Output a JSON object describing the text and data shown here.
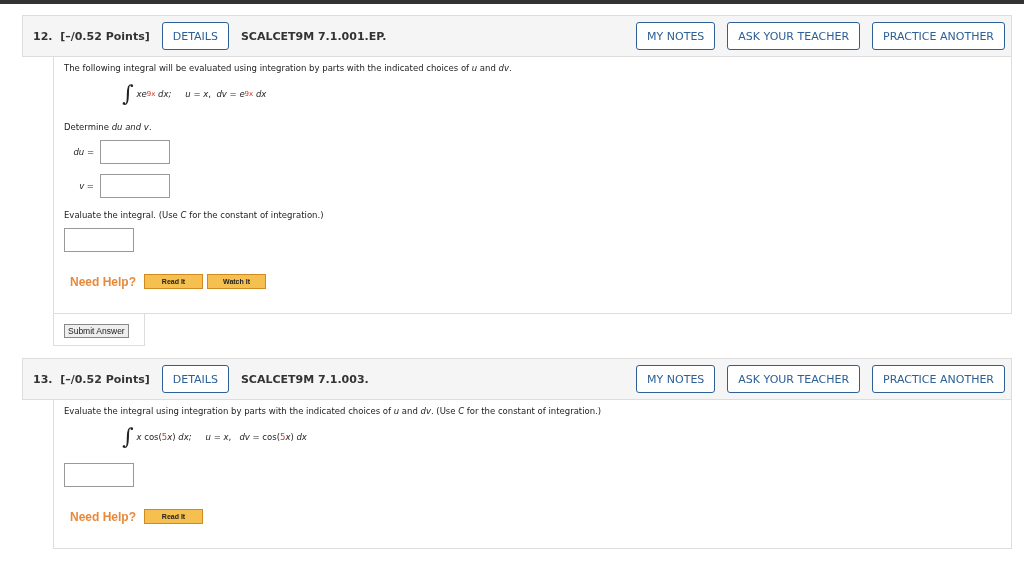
{
  "questions": [
    {
      "number": "12.",
      "points": "[–/0.52 Points]",
      "details": "DETAILS",
      "code": "SCALCET9M 7.1.001.EP.",
      "actions": [
        "MY NOTES",
        "ASK YOUR TEACHER",
        "PRACTICE ANOTHER"
      ],
      "blocks": [
        {
          "kind": "text",
          "text": "The following integral will be evaluated using integration by parts with the indicated choices of *u* and *dv*."
        },
        {
          "kind": "formula",
          "sign": "∫",
          "tokens": [
            {
              "kind": "var",
              "text": "xe"
            },
            {
              "kind": "sup",
              "text": "9x"
            },
            {
              "kind": "var",
              "text": " dx;"
            },
            {
              "kind": "gap"
            },
            {
              "kind": "var",
              "text": "u"
            },
            {
              "kind": "plain",
              "text": " = "
            },
            {
              "kind": "var",
              "text": "x"
            },
            {
              "kind": "plain",
              "text": ",  "
            },
            {
              "kind": "var",
              "text": "dv"
            },
            {
              "kind": "plain",
              "text": " = "
            },
            {
              "kind": "var",
              "text": "e"
            },
            {
              "kind": "sup",
              "text": "9x"
            },
            {
              "kind": "var",
              "text": " dx"
            }
          ]
        },
        {
          "kind": "text",
          "text": "Determine *du and v*."
        },
        {
          "kind": "labeled-field",
          "label": "du ="
        },
        {
          "kind": "labeled-field",
          "label": "v ="
        },
        {
          "kind": "text",
          "text": "Evaluate the integral. (Use *C* for the constant of integration.)"
        },
        {
          "kind": "field"
        },
        {
          "kind": "help",
          "label": "Need Help?",
          "buttons": [
            "Read It",
            "Watch It"
          ]
        }
      ],
      "submit": "Submit Answer"
    },
    {
      "number": "13.",
      "points": "[–/0.52 Points]",
      "details": "DETAILS",
      "code": "SCALCET9M 7.1.003.",
      "actions": [
        "MY NOTES",
        "ASK YOUR TEACHER",
        "PRACTICE ANOTHER"
      ],
      "blocks": [
        {
          "kind": "text",
          "text": "Evaluate the integral using integration by parts with the indicated choices of *u* and *dv*. (Use *C* for the constant of integration.)"
        },
        {
          "kind": "formula",
          "sign": "∫",
          "tokens": [
            {
              "kind": "var",
              "text": "x"
            },
            {
              "kind": "plain",
              "text": " cos("
            },
            {
              "kind": "red",
              "text": "5"
            },
            {
              "kind": "var",
              "text": "x"
            },
            {
              "kind": "plain",
              "text": ") "
            },
            {
              "kind": "var",
              "text": "dx;"
            },
            {
              "kind": "gap"
            },
            {
              "kind": "var",
              "text": "u"
            },
            {
              "kind": "plain",
              "text": " = "
            },
            {
              "kind": "var",
              "text": "x"
            },
            {
              "kind": "plain",
              "text": ",   "
            },
            {
              "kind": "var",
              "text": "dv"
            },
            {
              "kind": "plain",
              "text": " = cos("
            },
            {
              "kind": "red",
              "text": "5"
            },
            {
              "kind": "var",
              "text": "x"
            },
            {
              "kind": "plain",
              "text": ") "
            },
            {
              "kind": "var",
              "text": "dx"
            }
          ]
        },
        {
          "kind": "field"
        },
        {
          "kind": "help",
          "label": "Need Help?",
          "buttons": [
            "Read It"
          ]
        }
      ]
    }
  ]
}
